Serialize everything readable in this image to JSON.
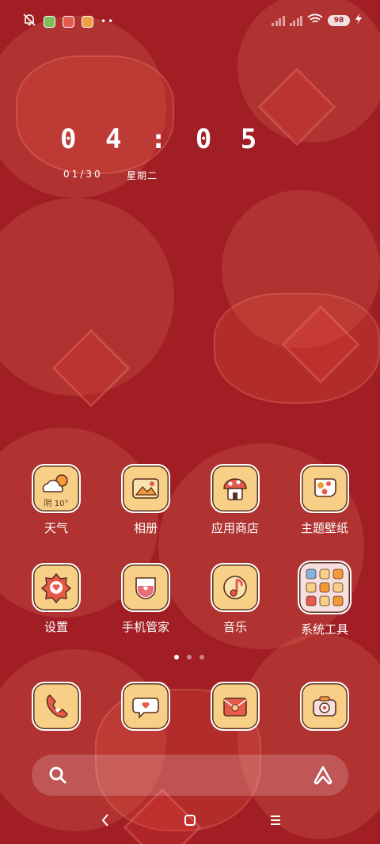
{
  "status_bar": {
    "left_icons": [
      "bell-off-icon",
      "app-notify-green",
      "app-notify-red",
      "app-notify-orange",
      "more-dots"
    ],
    "battery": "98",
    "charging": true
  },
  "lockclock": {
    "time": "04:05",
    "date": "01/30",
    "weekday": "星期二"
  },
  "apps_row1": [
    {
      "label": "天气",
      "icon": "weather-cloud-sun-icon",
      "temp": "阴 10°"
    },
    {
      "label": "相册",
      "icon": "photo-frame-icon"
    },
    {
      "label": "应用商店",
      "icon": "mushroom-house-icon"
    },
    {
      "label": "主题壁纸",
      "icon": "flower-paint-icon"
    }
  ],
  "apps_row2": [
    {
      "label": "设置",
      "icon": "heart-flower-gear-icon"
    },
    {
      "label": "手机管家",
      "icon": "shield-cup-icon"
    },
    {
      "label": "音乐",
      "icon": "music-note-icon"
    },
    {
      "label": "系统工具",
      "icon": "folder-grid-icon"
    }
  ],
  "dock": [
    {
      "icon": "phone-handset-icon"
    },
    {
      "icon": "chat-bubble-icon"
    },
    {
      "icon": "envelope-flower-icon"
    },
    {
      "icon": "camera-bag-icon"
    }
  ],
  "pager": {
    "pages": 3,
    "active": 0
  },
  "colors": {
    "background": "#a11f24",
    "icon_bg": "#f7cf86",
    "icon_outline": "#5b2e1e"
  }
}
